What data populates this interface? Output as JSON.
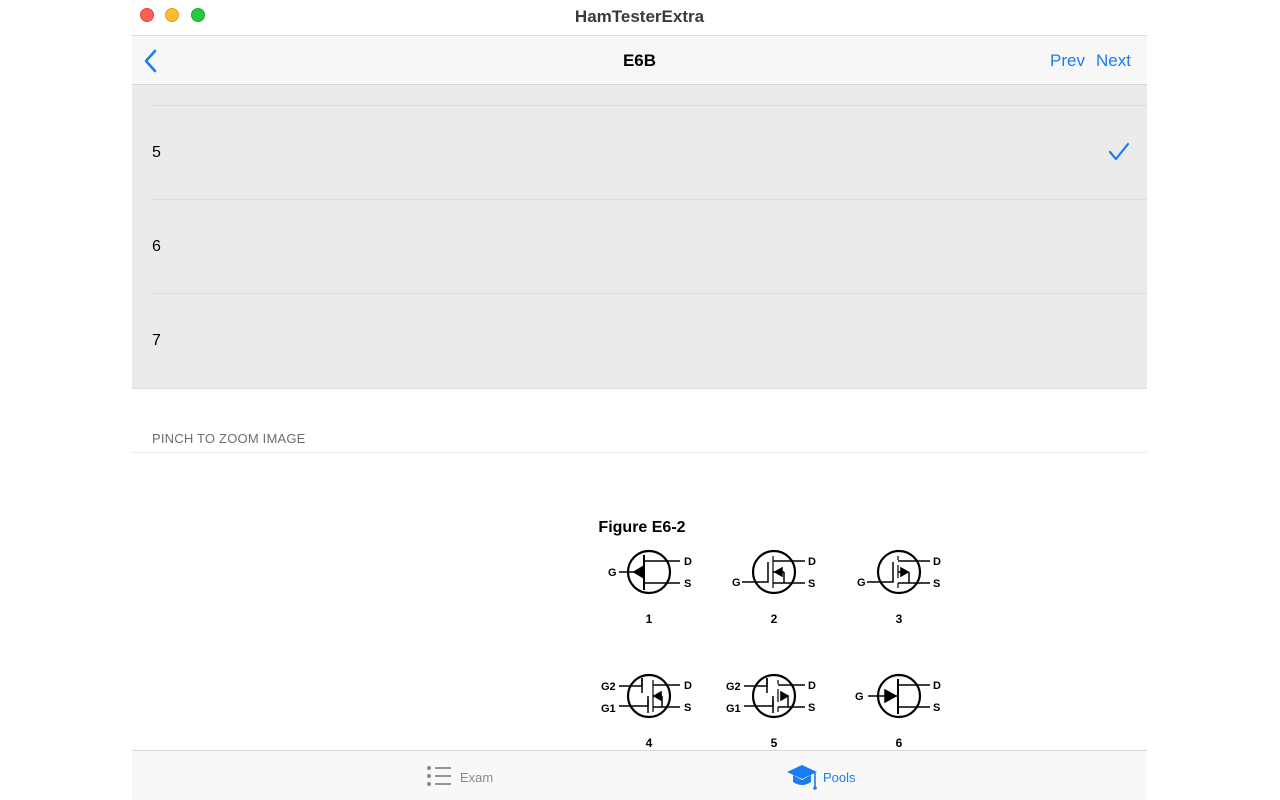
{
  "window": {
    "title": "HamTesterExtra"
  },
  "nav": {
    "title": "E6B",
    "prev_label": "Prev",
    "next_label": "Next"
  },
  "answers": [
    {
      "label": "5",
      "selected": true
    },
    {
      "label": "6",
      "selected": false
    },
    {
      "label": "7",
      "selected": false
    }
  ],
  "image_section": {
    "header": "PINCH TO ZOOM IMAGE"
  },
  "figure": {
    "title": "Figure E6-2",
    "symbols": [
      {
        "number": "1",
        "gate_labels": [
          "G"
        ],
        "terminal_labels": [
          "D",
          "S"
        ]
      },
      {
        "number": "2",
        "gate_labels": [
          "G"
        ],
        "terminal_labels": [
          "D",
          "S"
        ]
      },
      {
        "number": "3",
        "gate_labels": [
          "G"
        ],
        "terminal_labels": [
          "D",
          "S"
        ]
      },
      {
        "number": "4",
        "gate_labels": [
          "G2",
          "G1"
        ],
        "terminal_labels": [
          "D",
          "S"
        ]
      },
      {
        "number": "5",
        "gate_labels": [
          "G2",
          "G1"
        ],
        "terminal_labels": [
          "D",
          "S"
        ]
      },
      {
        "number": "6",
        "gate_labels": [
          "G"
        ],
        "terminal_labels": [
          "D",
          "S"
        ]
      }
    ]
  },
  "tabbar": {
    "tabs": [
      {
        "label": "Exam",
        "icon": "list-icon",
        "active": false
      },
      {
        "label": "Pools",
        "icon": "graduation-cap-icon",
        "active": true
      }
    ]
  },
  "colors": {
    "accent": "#1a7cf2",
    "list_background": "#ebebeb"
  }
}
